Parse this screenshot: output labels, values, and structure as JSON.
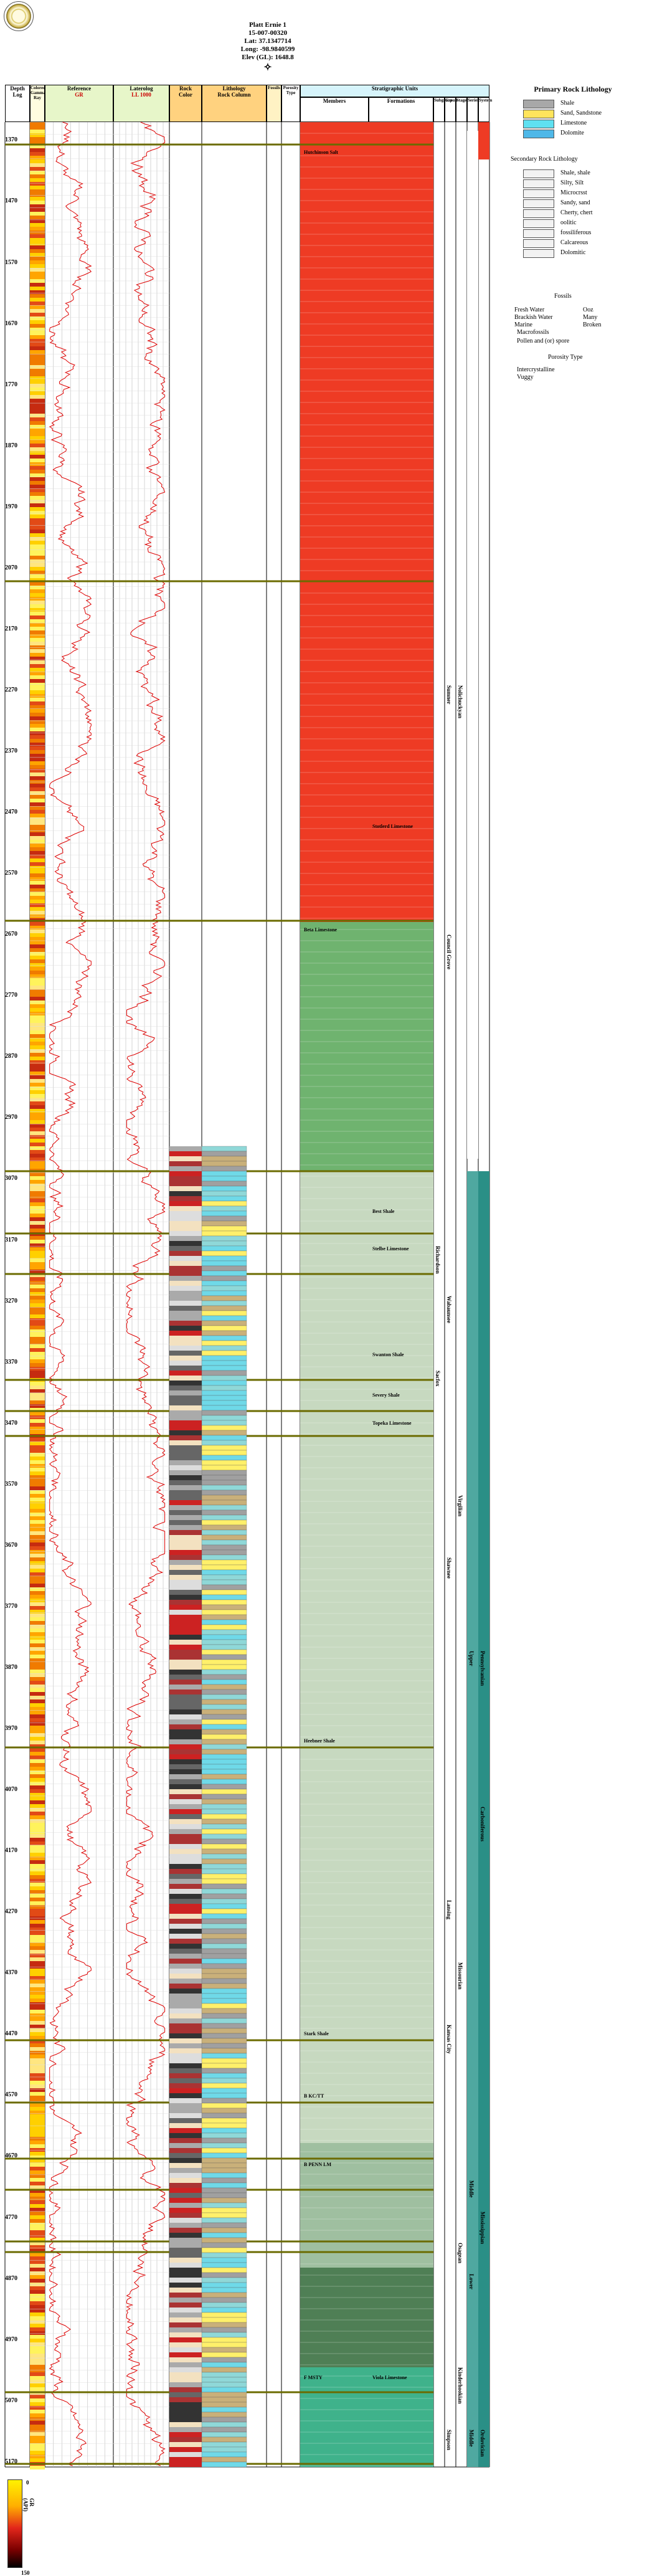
{
  "header": {
    "well_name": "Platt Ernie 1",
    "api": "15-007-00320",
    "lat": "Lat: 37.1347714",
    "long": "Long: -98.9840599",
    "elev": "Elev (GL): 1648.8"
  },
  "columns": {
    "depth": "Depth Log",
    "gamma": "Colored Gamma Ray",
    "reference": "Reference",
    "ref_units_1": "GR",
    "ref_units_2": "0 150",
    "ref_scale_left": "0",
    "ref_scale_right": "150",
    "laterolog": "Laterolog",
    "lat_scale": "LL 1000",
    "rock": "Rock",
    "rock_color": "Color",
    "lithology": "Lithology",
    "rock_column": "Rock Column",
    "rock_col_2": "Fossils",
    "porosity": "Porosity Type",
    "strat_head": "Stratigraphic Units",
    "members": "Members",
    "formations": "Formations",
    "subgroup": "Subgroup",
    "group": "Group",
    "stage": "Stage",
    "series": "Series",
    "system": "System"
  },
  "depths": [
    "1370",
    "1470",
    "1570",
    "1670",
    "1770",
    "1870",
    "1970",
    "2070",
    "2170",
    "2270",
    "2370",
    "2470",
    "2570",
    "2670",
    "2770",
    "2870",
    "2970",
    "3070",
    "3170",
    "3270",
    "3370",
    "3470",
    "3570",
    "3670",
    "3770",
    "3870",
    "3970",
    "4070",
    "4170",
    "4270",
    "4370",
    "4470",
    "4570",
    "4670",
    "4770",
    "4870",
    "4970",
    "5070",
    "5170"
  ],
  "units": [
    {
      "label": "Hutchinson Salt",
      "col": "members"
    },
    {
      "label": "Stotlerd Limestone",
      "col": "formations"
    },
    {
      "label": "Beta Limestone",
      "col": "members"
    },
    {
      "label": "Best Shale",
      "col": "formations"
    },
    {
      "label": "Stelbe Limestone",
      "col": "formations"
    },
    {
      "label": "Swanton Shale",
      "col": "formations"
    },
    {
      "label": "Severy Shale",
      "col": "formations"
    },
    {
      "label": "Topeka Limestone",
      "col": "formations"
    },
    {
      "label": "Heebner Shale",
      "col": "members"
    },
    {
      "label": "Stark Shale",
      "col": "members"
    },
    {
      "label": "B KC/TT",
      "col": "members"
    },
    {
      "label": "B PENN LM",
      "col": "members"
    },
    {
      "label": "F MSTY",
      "col": "members"
    },
    {
      "label": "Viola Limestone",
      "col": "formations"
    }
  ],
  "strat_vertical": [
    {
      "label": "Sumner",
      "col": "group"
    },
    {
      "label": "Nolichuckyan",
      "col": "stage"
    },
    {
      "label": "Council Grove",
      "col": "group"
    },
    {
      "label": "Richardson",
      "col": "subgroup"
    },
    {
      "label": "Wabaunsee",
      "col": "group"
    },
    {
      "label": "Sacfox",
      "col": "subgroup"
    },
    {
      "label": "Virgilian",
      "col": "stage"
    },
    {
      "label": "Shawnee",
      "col": "group"
    },
    {
      "label": "Upper",
      "col": "series"
    },
    {
      "label": "Pennsylvanian",
      "col": "system"
    },
    {
      "label": "Carboniferous",
      "col": "system"
    },
    {
      "label": "Lansing",
      "col": "group"
    },
    {
      "label": "Missourian",
      "col": "stage"
    },
    {
      "label": "Kansas City",
      "col": "group"
    },
    {
      "label": "Middle",
      "col": "series"
    },
    {
      "label": "Mississippian",
      "col": "system"
    },
    {
      "label": "Osagean",
      "col": "stage"
    },
    {
      "label": "Lower",
      "col": "series"
    },
    {
      "label": "Kinderhookian",
      "col": "stage"
    },
    {
      "label": "Middle",
      "col": "series"
    },
    {
      "label": "Ordovician",
      "col": "system"
    },
    {
      "label": "Simpson",
      "col": "group"
    }
  ],
  "legend": {
    "primary_title": "Primary Rock Lithology",
    "primary": [
      "Shale",
      "Sand, Sandstone",
      "Limestone",
      "Dolomite"
    ],
    "secondary_title": "Secondary Rock Lithology",
    "secondary": [
      "Shale, shale",
      "Silty, Silt",
      "Microcrsst",
      "Sandy, sand",
      "Cherty, chert",
      "oolitic",
      "fossiliferous",
      "Calcareous",
      "Dolomitic"
    ],
    "fossils_title": "Fossils",
    "fossils": [
      "Fresh Water",
      "Brackish Water",
      "Marine",
      "Ooz",
      "Many",
      "Broken",
      "Macrofossils",
      "Pollen and (or) spore"
    ],
    "porosity_title": "Porosity Type",
    "porosity": [
      "Intercrystalline",
      "Vuggy"
    ]
  },
  "gr_scale": {
    "label": "GR (API)",
    "min": "0",
    "max": "150"
  },
  "colors": {
    "strat_red": "#ee3b24",
    "strat_green": "#6fb36f",
    "strat_pale": "#c7d9c0",
    "strat_dark": "#4f7f55",
    "strat_teal": "#3fb28b",
    "strat_head": "#d6f4fb"
  }
}
